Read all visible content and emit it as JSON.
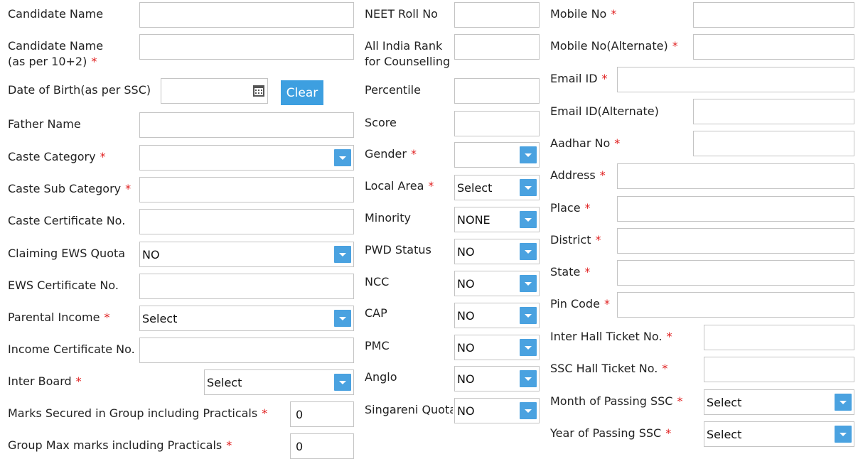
{
  "col1": {
    "candidate_name": {
      "label": "Candidate Name",
      "value": ""
    },
    "candidate_name_10_2": {
      "label_line1": "Candidate Name",
      "label_line2": "(as per 10+2)",
      "value": ""
    },
    "dob": {
      "label": "Date of Birth(as per SSC)",
      "value": "",
      "clear_label": "Clear"
    },
    "father_name": {
      "label": "Father Name",
      "value": ""
    },
    "caste_category": {
      "label": "Caste Category",
      "value": ""
    },
    "caste_sub_category": {
      "label": "Caste Sub Category",
      "value": ""
    },
    "caste_certificate": {
      "label": "Caste Certificate No.",
      "value": ""
    },
    "claiming_ews": {
      "label": "Claiming EWS Quota",
      "value": "NO"
    },
    "ews_certificate": {
      "label": "EWS Certificate No.",
      "value": ""
    },
    "parental_income": {
      "label": "Parental Income",
      "value": "Select"
    },
    "income_certificate": {
      "label": "Income Certificate No.",
      "value": ""
    },
    "inter_board": {
      "label": "Inter Board",
      "value": "Select"
    },
    "marks_secured": {
      "label": "Marks Secured in Group including Practicals",
      "value": "0"
    },
    "group_max_marks": {
      "label": "Group Max marks including Practicals",
      "value": "0"
    }
  },
  "col2": {
    "neet_roll": {
      "label": "NEET Roll No",
      "value": ""
    },
    "all_india_rank": {
      "label_line1": "All India Rank",
      "label_line2": "for Counselling",
      "value": ""
    },
    "percentile": {
      "label": "Percentile",
      "value": ""
    },
    "score": {
      "label": "Score",
      "value": ""
    },
    "gender": {
      "label": "Gender",
      "value": ""
    },
    "local_area": {
      "label": "Local Area",
      "value": "Select"
    },
    "minority": {
      "label": "Minority",
      "value": "NONE"
    },
    "pwd_status": {
      "label": "PWD Status",
      "value": "NO"
    },
    "ncc": {
      "label": "NCC",
      "value": "NO"
    },
    "cap": {
      "label": "CAP",
      "value": "NO"
    },
    "pmc": {
      "label": "PMC",
      "value": "NO"
    },
    "anglo": {
      "label": "Anglo",
      "value": "NO"
    },
    "singareni": {
      "label": "Singareni Quota",
      "value": "NO"
    }
  },
  "col3": {
    "mobile": {
      "label": "Mobile No",
      "value": ""
    },
    "mobile_alt": {
      "label": "Mobile No(Alternate)",
      "value": ""
    },
    "email": {
      "label": "Email ID",
      "value": ""
    },
    "email_alt": {
      "label": "Email ID(Alternate)",
      "value": ""
    },
    "aadhar": {
      "label": "Aadhar No",
      "value": ""
    },
    "address": {
      "label": "Address",
      "value": ""
    },
    "place": {
      "label": "Place",
      "value": ""
    },
    "district": {
      "label": "District",
      "value": ""
    },
    "state": {
      "label": "State",
      "value": ""
    },
    "pin_code": {
      "label": "Pin Code",
      "value": ""
    },
    "inter_hall_ticket": {
      "label": "Inter Hall Ticket No.",
      "value": ""
    },
    "ssc_hall_ticket": {
      "label": "SSC Hall Ticket No.",
      "value": ""
    },
    "month_passing_ssc": {
      "label": "Month of Passing SSC",
      "value": "Select"
    },
    "year_passing_ssc": {
      "label": "Year of Passing SSC",
      "value": "Select"
    }
  },
  "required_mark": "*",
  "colors": {
    "accent": "#4aa2e0",
    "required": "#e02020",
    "border": "#c4c4c4"
  },
  "icons": {
    "date": "calendar-icon",
    "dropdown": "chevron-down-icon"
  }
}
